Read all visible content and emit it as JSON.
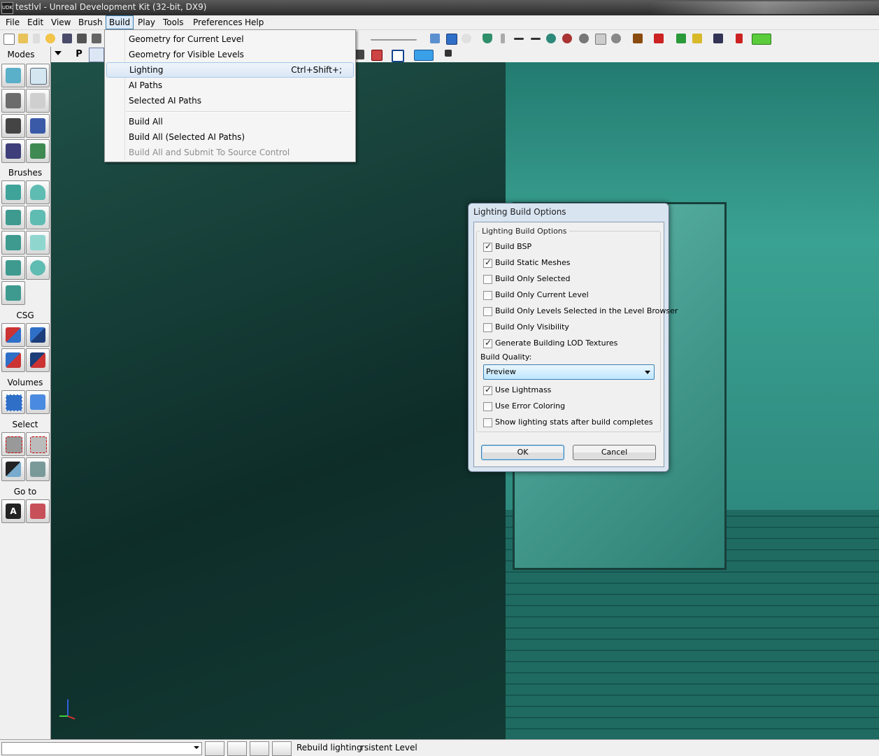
{
  "window": {
    "title": "testlvl - Unreal Development Kit (32-bit, DX9)",
    "app_icon": "udk-logo"
  },
  "menubar": {
    "items": [
      "File",
      "Edit",
      "View",
      "Brush",
      "Build",
      "Play",
      "Tools",
      "Preferences",
      "Help"
    ],
    "active": "Build"
  },
  "build_menu": {
    "items": [
      {
        "label": "Geometry for Current Level",
        "shortcut": "",
        "enabled": true
      },
      {
        "label": "Geometry for Visible Levels",
        "shortcut": "",
        "enabled": true
      },
      {
        "label": "Lighting",
        "shortcut": "Ctrl+Shift+;",
        "enabled": true,
        "highlighted": true
      },
      {
        "label": "AI Paths",
        "shortcut": "",
        "enabled": true
      },
      {
        "label": "Selected AI Paths",
        "shortcut": "",
        "enabled": true
      },
      {
        "label": "Build All",
        "shortcut": "",
        "enabled": true
      },
      {
        "label": "Build All (Selected AI Paths)",
        "shortcut": "",
        "enabled": true
      },
      {
        "label": "Build All and Submit To Source Control",
        "shortcut": "",
        "enabled": false
      }
    ]
  },
  "left_panel": {
    "sections": [
      "Modes",
      "Brushes",
      "CSG",
      "Volumes",
      "Select",
      "Go to"
    ],
    "mode_toggle": "P"
  },
  "dialog": {
    "title": "Lighting Build Options",
    "group_title": "Lighting Build Options",
    "options": [
      {
        "label": "Build BSP",
        "checked": true
      },
      {
        "label": "Build Static Meshes",
        "checked": true
      },
      {
        "label": "Build Only Selected",
        "checked": false
      },
      {
        "label": "Build Only Current Level",
        "checked": false
      },
      {
        "label": "Build Only Levels Selected in the Level Browser",
        "checked": false
      },
      {
        "label": "Build Only Visibility",
        "checked": false
      },
      {
        "label": "Generate Building LOD Textures",
        "checked": true
      }
    ],
    "quality_label": "Build Quality:",
    "quality_value": "Preview",
    "options2": [
      {
        "label": "Use Lightmass",
        "checked": true
      },
      {
        "label": "Use Error Coloring",
        "checked": false
      },
      {
        "label": "Show lighting stats after build completes",
        "checked": false
      }
    ],
    "ok_label": "OK",
    "cancel_label": "Cancel"
  },
  "statusbar": {
    "text1": "Rebuild lighting",
    "text2": "rsistent Level"
  },
  "colors": {
    "accent": "#3c7fb1",
    "viewport_teal": "#2a8a7e",
    "dialog_frame": "#d9e4f1"
  }
}
